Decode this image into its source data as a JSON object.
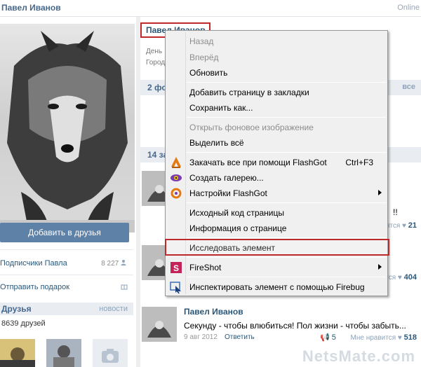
{
  "header": {
    "name": "Павел Иванов",
    "status": "Online"
  },
  "left": {
    "add_friend_label": "Добавить в друзья",
    "subscribers_label": "Подписчики Павла",
    "subscribers_count": "8 227",
    "gift_label": "Отправить подарок",
    "friends_title": "Друзья",
    "friends_news": "новости",
    "friends_count": "8639 друзей"
  },
  "profile": {
    "name": "Павел Иванов",
    "birthday_label": "День",
    "city_label": "Город",
    "photos_head": "2 фо",
    "photos_all": "все",
    "posts_head": "14 за"
  },
  "posts": [
    {
      "tail": "!!",
      "likes_label": "ятся",
      "likes": "21"
    },
    {
      "likes_label": "ятся",
      "likes": "404"
    },
    {
      "author": "Павел Иванов",
      "text": "Секунду - чтобы влюбиться! Пол жизни - чтобы забыть...",
      "date": "9 авг 2012",
      "reply": "Ответить",
      "likes_label": "Мне нравится",
      "likes": "518",
      "reposts": "5"
    }
  ],
  "context_menu": {
    "items": [
      {
        "label": "Назад",
        "disabled": true
      },
      {
        "label": "Вперёд",
        "disabled": true
      },
      {
        "label": "Обновить"
      },
      {
        "label": "Добавить страницу в закладки"
      },
      {
        "label": "Сохранить как..."
      },
      {
        "label": "Открыть фоновое изображение",
        "disabled": true
      },
      {
        "label": "Выделить всё"
      },
      {
        "label": "Закачать все при помощи FlashGot",
        "shortcut": "Ctrl+F3"
      },
      {
        "label": "Создать галерею..."
      },
      {
        "label": "Настройки FlashGot"
      },
      {
        "label": "Исходный код страницы"
      },
      {
        "label": "Информация о странице"
      },
      {
        "label": "Исследовать элемент"
      },
      {
        "label": "FireShot"
      },
      {
        "label": "Инспектировать элемент с помощью Firebug"
      }
    ]
  },
  "watermark": "NetsMate.com",
  "colors": {
    "accent": "#45688e",
    "highlight": "#c0292a",
    "button": "#5e81a8"
  }
}
